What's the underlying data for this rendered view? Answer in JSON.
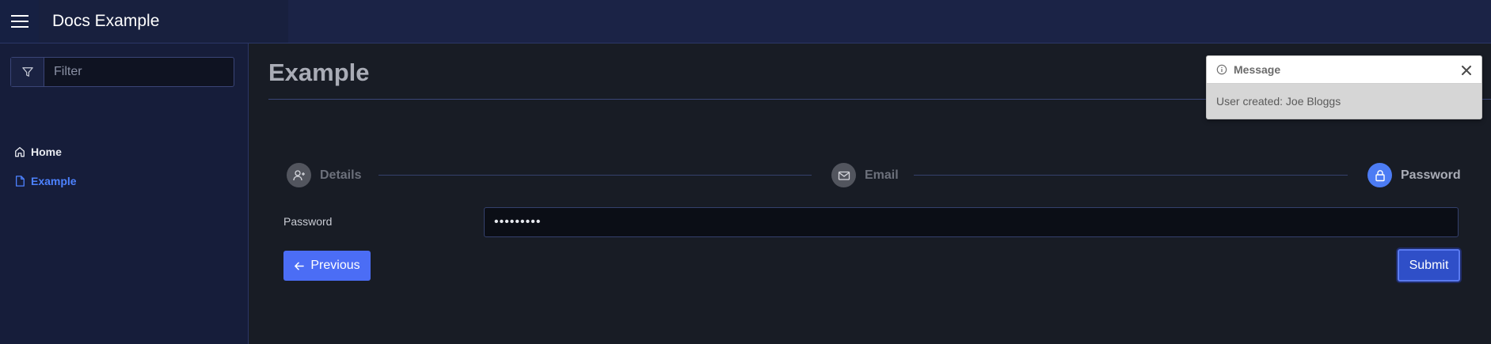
{
  "app": {
    "title": "Docs Example"
  },
  "sidebar": {
    "filter_placeholder": "Filter",
    "items": [
      {
        "label": "Home",
        "icon": "home-icon",
        "active": false
      },
      {
        "label": "Example",
        "icon": "document-icon",
        "active": true
      }
    ]
  },
  "main": {
    "title": "Example"
  },
  "stepper": {
    "steps": [
      {
        "label": "Details",
        "icon": "user-plus-icon",
        "active": false
      },
      {
        "label": "Email",
        "icon": "envelope-icon",
        "active": false
      },
      {
        "label": "Password",
        "icon": "lock-icon",
        "active": true
      }
    ]
  },
  "form": {
    "password_label": "Password",
    "password_value": "•••••••••",
    "previous_label": "Previous",
    "submit_label": "Submit"
  },
  "toast": {
    "title": "Message",
    "body": "User created: Joe Bloggs",
    "icon": "info-icon"
  },
  "colors": {
    "accent": "#4b6df5",
    "active_nav": "#4d82ff",
    "topbar": "#1b2346",
    "background": "#181c25"
  }
}
